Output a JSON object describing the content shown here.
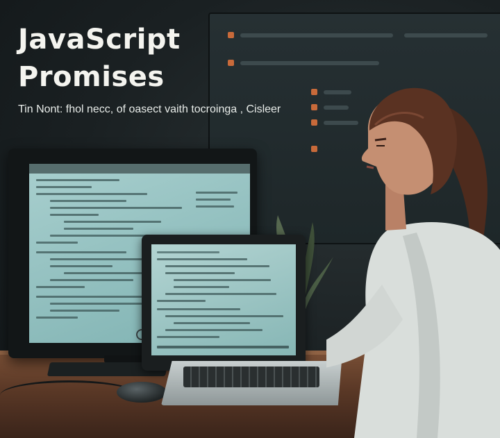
{
  "hero": {
    "title_line1": "JavaScript",
    "title_line2": "Promises",
    "subtitle": "Tin Nont: fhol necc, of oasect vaith tocroinga , Cisleer"
  },
  "colors": {
    "wall": "#263033",
    "accent_orange": "#c86a3a",
    "screen_teal": "#8fbfbe",
    "desk_wood": "#6b4530",
    "shirt": "#dfe3e0",
    "hair": "#5a3222",
    "skin": "#c58f72"
  }
}
